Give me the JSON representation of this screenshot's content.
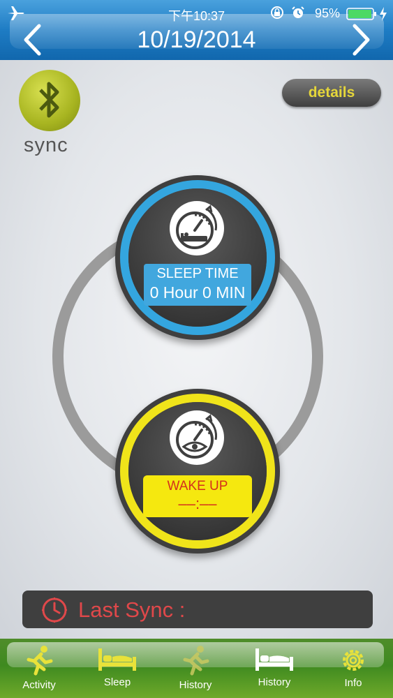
{
  "status_bar": {
    "time": "下午10:37",
    "battery_percent": "95%"
  },
  "header": {
    "date": "10/19/2014"
  },
  "sync": {
    "label": "sync"
  },
  "details_button": {
    "label": "details"
  },
  "sleep_time": {
    "title": "SLEEP TIME",
    "value": "0 Hour 0 MIN"
  },
  "wake_up": {
    "title": "WAKE UP",
    "value": "––:––"
  },
  "last_sync": {
    "label": "Last Sync :"
  },
  "tabs": [
    {
      "label": "Activity",
      "icon": "running-person-icon"
    },
    {
      "label": "Sleep",
      "icon": "bed-icon"
    },
    {
      "label": "History",
      "icon": "running-person-icon"
    },
    {
      "label": "History",
      "icon": "bed-icon"
    },
    {
      "label": "Info",
      "icon": "gear-icon"
    }
  ],
  "colors": {
    "header_blue": "#1e7cc4",
    "sleep_blue": "#34a6df",
    "wake_yellow": "#f0e41a",
    "details_text": "#e5d63a",
    "last_sync_red": "#e0484a",
    "tabbar_green": "#3f8a20",
    "tab_icon_yellow": "#e8e23a"
  }
}
